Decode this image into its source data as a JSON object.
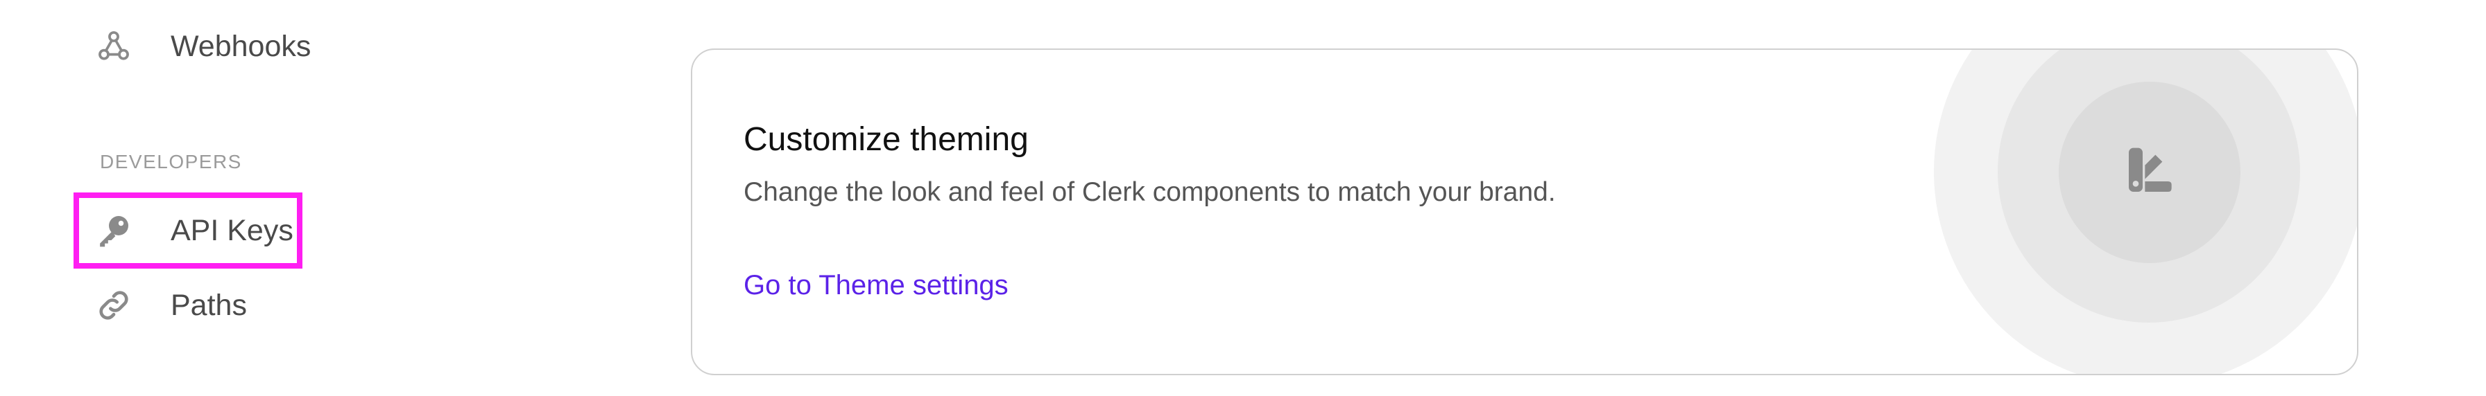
{
  "sidebar": {
    "items": [
      {
        "label": "Webhooks",
        "icon": "webhooks-icon"
      },
      {
        "label": "API Keys",
        "icon": "key-icon"
      },
      {
        "label": "Paths",
        "icon": "link-icon"
      }
    ],
    "section_header": "DEVELOPERS",
    "highlight_color": "#ff1ef2"
  },
  "card": {
    "title": "Customize theming",
    "description": "Change the look and feel of Clerk components to match your brand.",
    "link_label": "Go to Theme settings",
    "link_color": "#5b22e8",
    "illustration_icon": "theme-swatch-icon"
  }
}
